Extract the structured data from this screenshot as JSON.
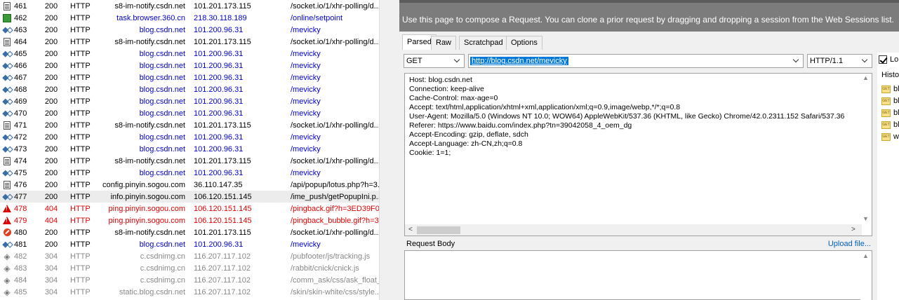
{
  "sessions": [
    {
      "icon": "document-icon",
      "num": "461",
      "result": "200",
      "protocol": "HTTP",
      "host": "s8-im-notify.csdn.net",
      "ip": "101.201.173.115",
      "url": "/socket.io/1/xhr-polling/d...",
      "color": "black"
    },
    {
      "icon": "green-script-icon",
      "num": "462",
      "result": "200",
      "protocol": "HTTP",
      "host": "task.browser.360.cn",
      "ip": "218.30.118.189",
      "url": "/online/setpoint",
      "color": "blue"
    },
    {
      "icon": "arrows-icon",
      "num": "463",
      "result": "200",
      "protocol": "HTTP",
      "host": "blog.csdn.net",
      "ip": "101.200.96.31",
      "url": "/mevicky",
      "color": "blue"
    },
    {
      "icon": "document-icon",
      "num": "464",
      "result": "200",
      "protocol": "HTTP",
      "host": "s8-im-notify.csdn.net",
      "ip": "101.201.173.115",
      "url": "/socket.io/1/xhr-polling/d...",
      "color": "black"
    },
    {
      "icon": "arrows-icon",
      "num": "465",
      "result": "200",
      "protocol": "HTTP",
      "host": "blog.csdn.net",
      "ip": "101.200.96.31",
      "url": "/mevicky",
      "color": "blue"
    },
    {
      "icon": "arrows-icon",
      "num": "466",
      "result": "200",
      "protocol": "HTTP",
      "host": "blog.csdn.net",
      "ip": "101.200.96.31",
      "url": "/mevicky",
      "color": "blue"
    },
    {
      "icon": "arrows-icon",
      "num": "467",
      "result": "200",
      "protocol": "HTTP",
      "host": "blog.csdn.net",
      "ip": "101.200.96.31",
      "url": "/mevicky",
      "color": "blue"
    },
    {
      "icon": "arrows-icon",
      "num": "468",
      "result": "200",
      "protocol": "HTTP",
      "host": "blog.csdn.net",
      "ip": "101.200.96.31",
      "url": "/mevicky",
      "color": "blue"
    },
    {
      "icon": "arrows-icon",
      "num": "469",
      "result": "200",
      "protocol": "HTTP",
      "host": "blog.csdn.net",
      "ip": "101.200.96.31",
      "url": "/mevicky",
      "color": "blue"
    },
    {
      "icon": "arrows-icon",
      "num": "470",
      "result": "200",
      "protocol": "HTTP",
      "host": "blog.csdn.net",
      "ip": "101.200.96.31",
      "url": "/mevicky",
      "color": "blue"
    },
    {
      "icon": "document-icon",
      "num": "471",
      "result": "200",
      "protocol": "HTTP",
      "host": "s8-im-notify.csdn.net",
      "ip": "101.201.173.115",
      "url": "/socket.io/1/xhr-polling/d...",
      "color": "black"
    },
    {
      "icon": "arrows-icon",
      "num": "472",
      "result": "200",
      "protocol": "HTTP",
      "host": "blog.csdn.net",
      "ip": "101.200.96.31",
      "url": "/mevicky",
      "color": "blue"
    },
    {
      "icon": "arrows-icon",
      "num": "473",
      "result": "200",
      "protocol": "HTTP",
      "host": "blog.csdn.net",
      "ip": "101.200.96.31",
      "url": "/mevicky",
      "color": "blue"
    },
    {
      "icon": "document-icon",
      "num": "474",
      "result": "200",
      "protocol": "HTTP",
      "host": "s8-im-notify.csdn.net",
      "ip": "101.201.173.115",
      "url": "/socket.io/1/xhr-polling/d...",
      "color": "black"
    },
    {
      "icon": "arrows-icon",
      "num": "475",
      "result": "200",
      "protocol": "HTTP",
      "host": "blog.csdn.net",
      "ip": "101.200.96.31",
      "url": "/mevicky",
      "color": "blue"
    },
    {
      "icon": "document-icon",
      "num": "476",
      "result": "200",
      "protocol": "HTTP",
      "host": "config.pinyin.sogou.com",
      "ip": "36.110.147.35",
      "url": "/api/popup/lotus.php?h=3...",
      "color": "black"
    },
    {
      "icon": "arrows-icon",
      "num": "477",
      "result": "200",
      "protocol": "HTTP",
      "host": "info.pinyin.sogou.com",
      "ip": "106.120.151.145",
      "url": "/ime_push/getPopupIni.p...",
      "color": "black",
      "selected": true
    },
    {
      "icon": "warning-icon",
      "num": "478",
      "result": "404",
      "protocol": "HTTP",
      "host": "ping.pinyin.sogou.com",
      "ip": "106.120.151.145",
      "url": "/pingback.gif?h=3ED39F0...",
      "color": "red"
    },
    {
      "icon": "warning-icon",
      "num": "479",
      "result": "404",
      "protocol": "HTTP",
      "host": "ping.pinyin.sogou.com",
      "ip": "106.120.151.145",
      "url": "/pingback_bubble.gif?h=3...",
      "color": "red"
    },
    {
      "icon": "blocked-icon",
      "num": "480",
      "result": "200",
      "protocol": "HTTP",
      "host": "s8-im-notify.csdn.net",
      "ip": "101.201.173.115",
      "url": "/socket.io/1/xhr-polling/d...",
      "color": "black"
    },
    {
      "icon": "arrows-icon",
      "num": "481",
      "result": "200",
      "protocol": "HTTP",
      "host": "blog.csdn.net",
      "ip": "101.200.96.31",
      "url": "/mevicky",
      "color": "blue"
    },
    {
      "icon": "diamond-icon",
      "num": "482",
      "result": "304",
      "protocol": "HTTP",
      "host": "c.csdnimg.cn",
      "ip": "116.207.117.102",
      "url": "/pubfooter/js/tracking.js",
      "color": "gray"
    },
    {
      "icon": "diamond-icon",
      "num": "483",
      "result": "304",
      "protocol": "HTTP",
      "host": "c.csdnimg.cn",
      "ip": "116.207.117.102",
      "url": "/rabbit/cnick/cnick.js",
      "color": "gray"
    },
    {
      "icon": "diamond-icon",
      "num": "484",
      "result": "304",
      "protocol": "HTTP",
      "host": "c.csdnimg.cn",
      "ip": "116.207.117.102",
      "url": "/comm_ask/css/ask_float_...",
      "color": "gray"
    },
    {
      "icon": "diamond-icon",
      "num": "485",
      "result": "304",
      "protocol": "HTTP",
      "host": "static.blog.csdn.net",
      "ip": "116.207.117.102",
      "url": "/skin/skin-white/css/style...",
      "color": "gray"
    }
  ],
  "composer": {
    "banner": "Use this page to compose a Request. You can clone a prior request by dragging and dropping a session from the Web Sessions list.",
    "tabs": [
      "Parsed",
      "Raw",
      "Scratchpad",
      "Options"
    ],
    "method": "GET",
    "url": "http://blog.csdn.net/mevicky",
    "http_version": "HTTP/1.1",
    "headers": [
      "Host: blog.csdn.net",
      "Connection: keep-alive",
      "Cache-Control: max-age=0",
      "Accept: text/html,application/xhtml+xml,application/xml;q=0.9,image/webp,*/*;q=0.8",
      "User-Agent: Mozilla/5.0 (Windows NT 10.0; WOW64) AppleWebKit/537.36 (KHTML, like Gecko) Chrome/42.0.2311.152 Safari/537.36",
      "Referer: https://www.baidu.com/index.php?tn=39042058_4_oem_dg",
      "Accept-Encoding: gzip, deflate, sdch",
      "Accept-Language: zh-CN,zh;q=0.8",
      "Cookie: 1=1;"
    ],
    "request_body_label": "Request Body",
    "upload_link": "Upload file..."
  },
  "history": {
    "log_label": "Lo",
    "title": "Histo",
    "items": [
      "bl",
      "bl",
      "bl",
      "bl",
      "w"
    ]
  },
  "colors": {
    "blue_text": "#0000cc",
    "red_text": "#e00000",
    "gray_text": "#888888",
    "banner_bg": "#7c7c7c",
    "url_highlight": "#0078d7"
  }
}
